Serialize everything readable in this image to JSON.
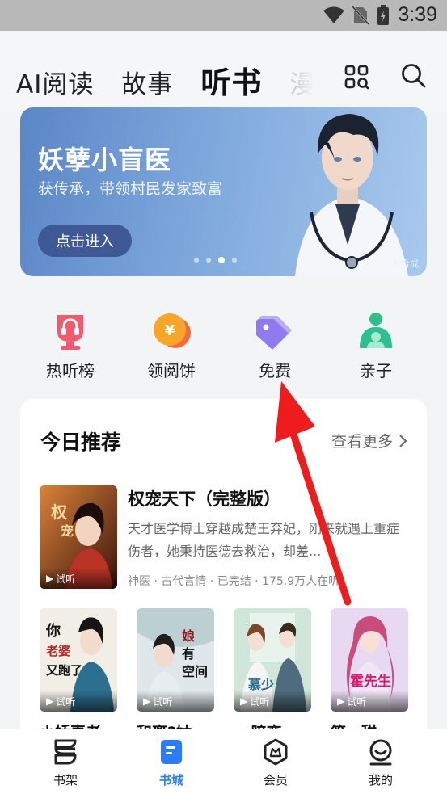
{
  "status_bar": {
    "time": "3:39"
  },
  "nav": {
    "tabs": [
      {
        "label": "AI阅读"
      },
      {
        "label": "故事"
      },
      {
        "label": "听书"
      },
      {
        "label": "漫画"
      }
    ],
    "active_tab": "听书"
  },
  "banner": {
    "title": "妖孽小盲医",
    "subtitle": "获传承，带领村民发家致富",
    "button_label": "点击进入",
    "ai_tag": "AI合成",
    "active_dot": 3,
    "dot_count": 4
  },
  "quick_links": [
    {
      "label": "热听榜",
      "icon": "headphones-trophy-icon",
      "color": "#f15a6f"
    },
    {
      "label": "领阅饼",
      "icon": "coin-icon",
      "color": "#f7a629"
    },
    {
      "label": "免费",
      "icon": "tag-icon",
      "color": "#8f7af0"
    },
    {
      "label": "亲子",
      "icon": "parent-child-icon",
      "color": "#2dbf8c"
    }
  ],
  "recommend": {
    "title": "今日推荐",
    "more_label": "查看更多",
    "featured": {
      "title": "权宠天下（完整版）",
      "description": "天才医学博士穿越成楚王弃妃，刚来就遇上重症伤者，她秉持医德去救治，却差...",
      "meta": "神医 · 古代言情 · 已完结 · 175.9万人在听",
      "trial_label": "试听"
    },
    "books": [
      {
        "title": "小娇妻老...",
        "trial_label": "试听"
      },
      {
        "title": "和离?姑...",
        "trial_label": "试听"
      },
      {
        "title": "...暗恋...",
        "trial_label": "试听"
      },
      {
        "title": "第一甜...",
        "trial_label": "试听"
      }
    ]
  },
  "tabbar": [
    {
      "label": "书架",
      "icon": "bookshelf-icon"
    },
    {
      "label": "书城",
      "icon": "bookstore-icon"
    },
    {
      "label": "会员",
      "icon": "vip-icon"
    },
    {
      "label": "我的",
      "icon": "profile-icon"
    }
  ],
  "active_tabbar": "书城",
  "accent_color": "#2b7cf6",
  "annotation_arrow_color": "#ee1c1c"
}
